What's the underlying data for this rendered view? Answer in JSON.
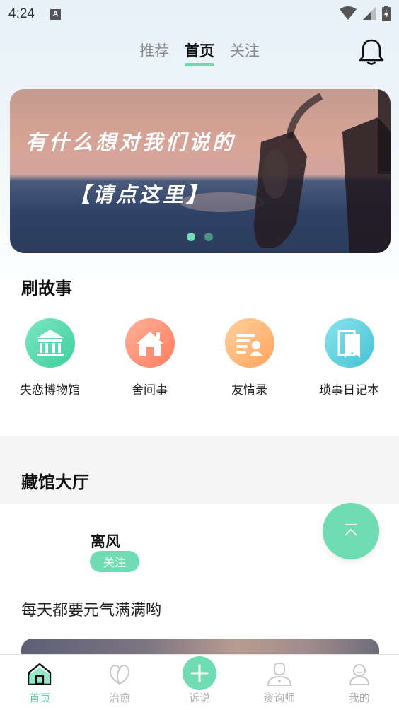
{
  "status_bar": {
    "time": "4:24",
    "notification_letter": "A"
  },
  "top_nav": {
    "tabs": [
      {
        "label": "推荐",
        "active": false
      },
      {
        "label": "首页",
        "active": true
      },
      {
        "label": "关注",
        "active": false
      }
    ],
    "bell_icon": "bell-icon"
  },
  "banner": {
    "line1": "有什么想对我们说的",
    "line2": "【请点这里】",
    "page_count": 2,
    "active_index": 0
  },
  "story_section": {
    "title": "刷故事",
    "items": [
      {
        "label": "失恋博物馆",
        "icon": "museum-icon",
        "color": "#4fd6a8"
      },
      {
        "label": "舍间事",
        "icon": "house-icon",
        "color": "#ff8f73"
      },
      {
        "label": "友情录",
        "icon": "friend-card-icon",
        "color": "#ffb877"
      },
      {
        "label": "琐事日记本",
        "icon": "notebook-icon",
        "color": "#5cd0de"
      }
    ]
  },
  "hall_section": {
    "title": "藏馆大厅"
  },
  "post": {
    "author": "离风",
    "follow_label": "关注",
    "text": "每天都要元气满满哟"
  },
  "float_button_icon": "scroll-top-icon",
  "tab_bar": {
    "tabs": [
      {
        "label": "首页",
        "icon": "home-icon",
        "active": true
      },
      {
        "label": "治愈",
        "icon": "heal-icon",
        "active": false
      },
      {
        "label": "诉说",
        "icon": "plus-icon",
        "active": false
      },
      {
        "label": "资询师",
        "icon": "counselor-icon",
        "active": false
      },
      {
        "label": "我的",
        "icon": "profile-icon",
        "active": false
      }
    ]
  },
  "colors": {
    "accent": "#6fdcb3",
    "accent_text": "#5fd1a6"
  }
}
